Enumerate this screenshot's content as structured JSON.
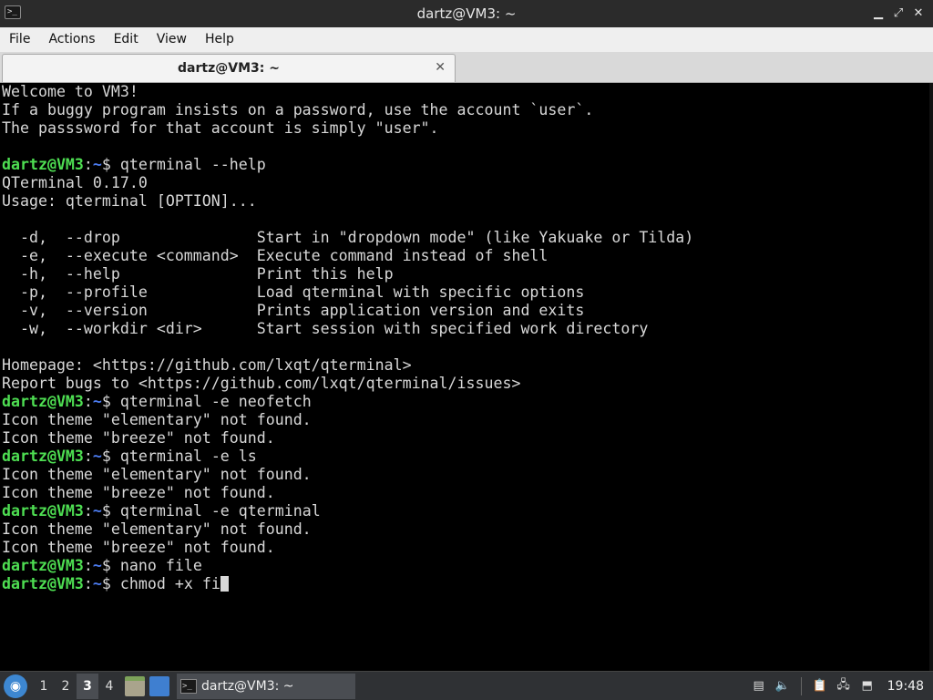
{
  "window": {
    "title": "dartz@VM3: ~",
    "controls": {
      "minimize": "▁",
      "maximize": "⤢",
      "close": "✕"
    }
  },
  "menubar": {
    "items": [
      "File",
      "Actions",
      "Edit",
      "View",
      "Help"
    ]
  },
  "tabs": [
    {
      "label": "dartz@VM3: ~",
      "close": "✕"
    }
  ],
  "terminal": {
    "lines": [
      {
        "text": "Welcome to VM3!"
      },
      {
        "text": "If a buggy program insists on a password, use the account `user`."
      },
      {
        "text": "The passsword for that account is simply \"user\"."
      },
      {
        "text": ""
      },
      {
        "prompt": true,
        "user": "dartz@VM3",
        "path": "~",
        "cmd": " qterminal --help"
      },
      {
        "text": "QTerminal 0.17.0"
      },
      {
        "text": "Usage: qterminal [OPTION]..."
      },
      {
        "text": ""
      },
      {
        "text": "  -d,  --drop               Start in \"dropdown mode\" (like Yakuake or Tilda)"
      },
      {
        "text": "  -e,  --execute <command>  Execute command instead of shell"
      },
      {
        "text": "  -h,  --help               Print this help"
      },
      {
        "text": "  -p,  --profile            Load qterminal with specific options"
      },
      {
        "text": "  -v,  --version            Prints application version and exits"
      },
      {
        "text": "  -w,  --workdir <dir>      Start session with specified work directory"
      },
      {
        "text": ""
      },
      {
        "text": "Homepage: <https://github.com/lxqt/qterminal>"
      },
      {
        "text": "Report bugs to <https://github.com/lxqt/qterminal/issues>"
      },
      {
        "prompt": true,
        "user": "dartz@VM3",
        "path": "~",
        "cmd": " qterminal -e neofetch"
      },
      {
        "text": "Icon theme \"elementary\" not found."
      },
      {
        "text": "Icon theme \"breeze\" not found."
      },
      {
        "prompt": true,
        "user": "dartz@VM3",
        "path": "~",
        "cmd": " qterminal -e ls"
      },
      {
        "text": "Icon theme \"elementary\" not found."
      },
      {
        "text": "Icon theme \"breeze\" not found."
      },
      {
        "prompt": true,
        "user": "dartz@VM3",
        "path": "~",
        "cmd": " qterminal -e qterminal"
      },
      {
        "text": "Icon theme \"elementary\" not found."
      },
      {
        "text": "Icon theme \"breeze\" not found."
      },
      {
        "prompt": true,
        "user": "dartz@VM3",
        "path": "~",
        "cmd": " nano file"
      },
      {
        "prompt": true,
        "user": "dartz@VM3",
        "path": "~",
        "cmd": " chmod +x fi",
        "cursor": true
      }
    ],
    "colors": {
      "user": "#4ede52",
      "path": "#4b7bef",
      "text": "#d8d8d8",
      "background": "#000000"
    }
  },
  "taskbar": {
    "start_icon": "lxqt-start-icon",
    "workspaces": [
      {
        "label": "1",
        "active": false
      },
      {
        "label": "2",
        "active": false
      },
      {
        "label": "3",
        "active": true
      },
      {
        "label": "4",
        "active": false
      }
    ],
    "quicklaunch": [
      "file-manager-icon",
      "show-desktop-icon"
    ],
    "task": {
      "label": "dartz@VM3: ~",
      "icon": "terminal-icon"
    },
    "tray": [
      "removable-media-icon",
      "volume-icon",
      "clipboard-icon",
      "network-icon",
      "update-icon"
    ],
    "clock": "19:48"
  }
}
